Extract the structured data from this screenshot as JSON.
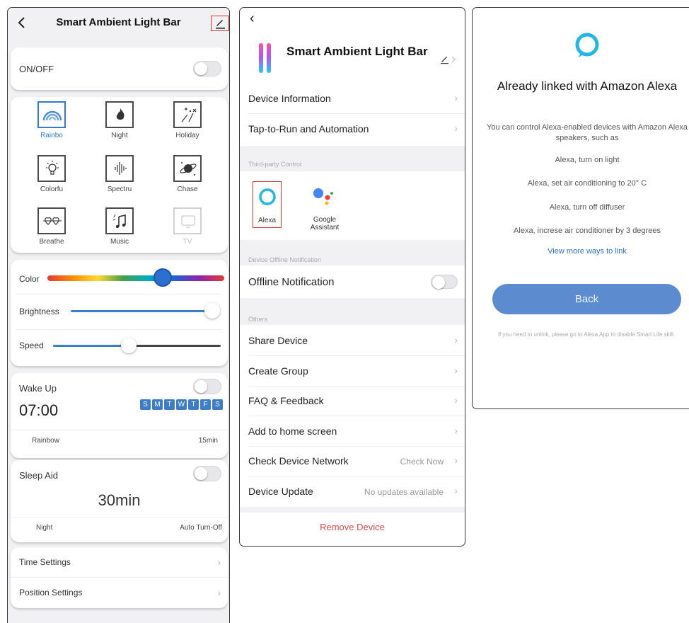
{
  "screen1": {
    "title": "Smart Ambient Light Bar",
    "onoff_label": "ON/OFF",
    "modes": [
      {
        "name": "Rainbo",
        "icon": "rainbow-icon",
        "selected": true
      },
      {
        "name": "Night",
        "icon": "flame-icon"
      },
      {
        "name": "Holiday",
        "icon": "fireworks-icon"
      },
      {
        "name": "Colorfu",
        "icon": "bulb-icon"
      },
      {
        "name": "Spectru",
        "icon": "soundwave-icon"
      },
      {
        "name": "Chase",
        "icon": "planet-icon"
      },
      {
        "name": "Breathe",
        "icon": "hearts-icon"
      },
      {
        "name": "Music",
        "icon": "music-note-icon"
      },
      {
        "name": "TV",
        "icon": "tv-icon",
        "disabled": true
      }
    ],
    "color_label": "Color",
    "color_level": 0.65,
    "brightness_label": "Brightness",
    "brightness_level": 1.0,
    "speed_label": "Speed",
    "speed_level": 0.45,
    "wake_up": {
      "label": "Wake Up",
      "time": "07:00",
      "days": [
        "S",
        "M",
        "T",
        "W",
        "T",
        "F",
        "S"
      ],
      "mode": "Rainbow",
      "duration": "15min"
    },
    "sleep_aid": {
      "label": "Sleep Aid",
      "duration": "30min",
      "mode": "Night",
      "action": "Auto Turn-Off"
    },
    "time_settings": "Time Settings",
    "position_settings": "Position Settings"
  },
  "screen2": {
    "title": "Smart Ambient Light Bar",
    "device_information": "Device Information",
    "tap_to_run": "Tap-to-Run and Automation",
    "third_party_header": "Third-party Control",
    "alexa_label": "Alexa",
    "google_label": "Google Assistant",
    "offline_header": "Device Offline Notification",
    "offline_notification": "Offline Notification",
    "others_header": "Others",
    "share_device": "Share Device",
    "create_group": "Create Group",
    "faq": "FAQ & Feedback",
    "add_home": "Add to home screen",
    "check_network": "Check Device Network",
    "check_now": "Check Now",
    "device_update": "Device Update",
    "no_updates": "No updates available",
    "remove_device": "Remove Device"
  },
  "screen3": {
    "title": "Already linked with Amazon Alexa",
    "intro": "You can control Alexa-enabled devices with Amazon Alexa speakers, such as",
    "examples": [
      "Alexa, turn on light",
      "Alexa, set air conditioning to 20° C",
      "Alexa, turn off diffuser",
      "Alexa, increse air conditioner by 3 degrees"
    ],
    "link": "View more ways to link",
    "back_button": "Back",
    "note": "If you need to unlink, please go to Alexa App to disable Smart Life skill."
  },
  "colors": {
    "accent_blue": "#2f7bd0",
    "remove_red": "#e5484d",
    "alexa_cyan": "#1fb6e8",
    "back_button": "#5d8bd0",
    "highlight_box": "#dd3333"
  }
}
